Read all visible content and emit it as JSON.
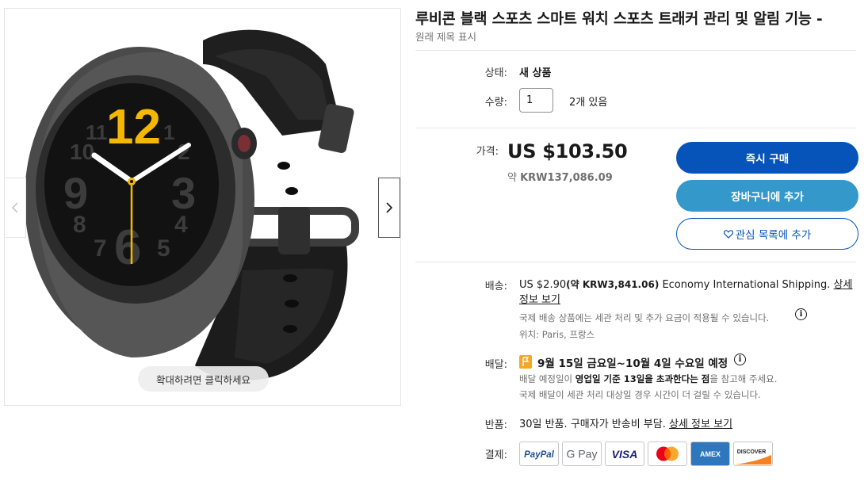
{
  "gallery": {
    "zoom_hint": "확대하려면 클릭하세요",
    "watch_numerals": [
      "12",
      "11",
      "1",
      "10",
      "2",
      "9",
      "3",
      "8",
      "4",
      "7",
      "6",
      "5"
    ]
  },
  "listing": {
    "title": "루비콘 블랙 스포츠 스마트 워치 스포츠 트래커 관리 및 알림 기능 -",
    "subtitle": "원래 제목 표시"
  },
  "condition": {
    "label": "상태:",
    "value": "새 상품"
  },
  "quantity": {
    "label": "수량:",
    "value": "1",
    "available": "2개 있음"
  },
  "price": {
    "label": "가격:",
    "amount": "US $103.50",
    "approx_prefix": "약 ",
    "approx_value": "KRW137,086.09"
  },
  "actions": {
    "buy_now": "즉시 구매",
    "add_to_cart": "장바구니에 추가",
    "add_to_watchlist": "관심 목록에 추가"
  },
  "shipping": {
    "label": "배송:",
    "amount": "US $2.90",
    "approx": "(약 KRW3,841.06)",
    "method": " Economy International Shipping. ",
    "details_link_1": "상세",
    "details_link_2": "정보 보기",
    "note": "국제 배송 상품에는 세관 처리 및 추가 요금이 적용될 수 있습니다.",
    "location": "위치: Paris, 프랑스"
  },
  "delivery": {
    "label": "배달:",
    "estimate": "9월 15일 금요일~10월 4일 수요일 예정",
    "note_1_pre": "배달 예정일이 ",
    "note_1_bold": "영업일 기준 13일을 초과한다는 점",
    "note_1_post": "을 참고해 주세요.",
    "note_2": "국제 배달이 세관 처리 대상일 경우 시간이 더 걸릴 수 있습니다."
  },
  "returns": {
    "label": "반품:",
    "text": "30일 반품. 구매자가 반송비 부담. ",
    "link": "상세 정보 보기"
  },
  "payments": {
    "label": "결제:",
    "methods": [
      "PayPal",
      "G Pay",
      "VISA",
      "Mastercard",
      "AMEX",
      "DISCOVER"
    ]
  },
  "colors": {
    "buy_blue": "#0654ba",
    "cart_blue": "#3498ca",
    "dial_yellow": "#f5b800",
    "flag_orange": "#f5a623"
  }
}
